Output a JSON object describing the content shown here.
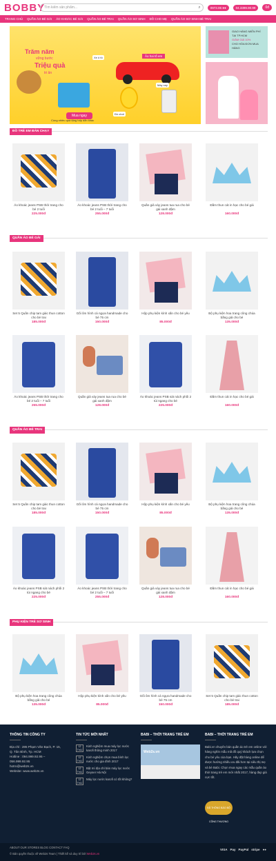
{
  "header": {
    "logo": "BOBBY",
    "search_placeholder": "Tìm kiếm sản phẩm...",
    "hotline_label": "0973.06 ●●",
    "hotline2_label": "04.3399.90.99",
    "cart_label": "0đ"
  },
  "nav": [
    "TRANG CHỦ",
    "QUẦN ÁO BÉ GÁI",
    "ÁO KHOÁC BÉ GÁI",
    "QUẦN ÁO BÉ TRAI",
    "QUẦN ÁO SƠ SINH",
    "ĐỒ CHO MẸ",
    "QUẦN ÁO SƠ SINH BÉ TRAI"
  ],
  "banner": {
    "line1": "Trăm năm",
    "line2": "vững bước",
    "line3": "Triệu quà",
    "line4": "tri ân",
    "button": "Mua ngay",
    "caption": "Cùng nhiều quà tặng hấp dẫn khác",
    "tag": "Ảo hai tố em",
    "label_car": "Xe ô tô",
    "label_chick": "Đồ chơi",
    "label_blender": "Máy xay"
  },
  "side": {
    "text1": "GIAO HÀNG MIỄN PHÍ",
    "text2": "TẠI TP.HCM",
    "text3": "GIẢM GIÁ 10%",
    "text4": "CHO HÓA ĐƠN MUA HÀNG"
  },
  "sections": [
    {
      "title": "ĐỒ TRẺ EM BÁN CHẠY",
      "products": [
        {
          "name": "Áo khoác jeans PSB thời trang cho bé 2 tuổi",
          "price": "225.000đ"
        },
        {
          "name": "Áo khoác jeans PSB thời trang cho bé 2 tuổi – 7 tuổi",
          "price": "255.000đ"
        },
        {
          "name": "Quần giả váy jeans tua rua cho bé gái xanh đậm",
          "price": "128.000đ"
        },
        {
          "name": "Đầm thun cát in hạc cho bé gái",
          "price": "160.000đ"
        }
      ]
    },
    {
      "title": "QUẦN ÁO BÉ GÁI",
      "products": [
        {
          "name": "Set 5 Quần chip tam giác thun cotton cho bé trai",
          "price": "185.000đ"
        },
        {
          "name": "Gối ôm hình cá ngựa handmade cho bé 75 cm",
          "price": "150.000đ"
        },
        {
          "name": "Hộp phụ kiện kính xấn cho bé yêu",
          "price": "85.000đ"
        },
        {
          "name": "Bộ phụ kiện hoa trang công chúa bằng giả cho bé",
          "price": "135.000đ"
        },
        {
          "name": "Áo khoác jeans PSB thời trang cho bé 2 tuổi – 7 tuổi",
          "price": "255.000đ"
        },
        {
          "name": "Quần giả váy jeans tua rua cho bé gái xanh đậm",
          "price": "128.000đ"
        },
        {
          "name": "Áo khoác jeans PSB sát nách phối 2 túi ngang cho bé",
          "price": "225.000đ"
        },
        {
          "name": "Đầm thun cát in hạc cho bé gái",
          "price": "160.000đ"
        }
      ]
    },
    {
      "title": "QUẦN ÁO BÉ TRAI",
      "products": [
        {
          "name": "Set 5 Quần chip tam giác thun cotton cho bé trai",
          "price": "185.000đ"
        },
        {
          "name": "Gối ôm hình cá ngựa handmade cho bé 75 cm",
          "price": "150.000đ"
        },
        {
          "name": "Hộp phụ kiện kính xấn cho bé yêu",
          "price": "85.000đ"
        },
        {
          "name": "Bộ phụ kiện hoa trang công chúa bằng giả cho bé",
          "price": "135.000đ"
        },
        {
          "name": "Áo khoác jeans PSB sát nách phối 2 túi ngang cho bé",
          "price": "225.000đ"
        },
        {
          "name": "Áo khoác jeans PSB thời trang cho bé 2 tuổi – 7 tuổi",
          "price": "255.000đ"
        },
        {
          "name": "Quần giả váy jeans tua rua cho bé gái xanh đậm",
          "price": "128.000đ"
        },
        {
          "name": "Đầm thun cát in hạc cho bé gái",
          "price": "160.000đ"
        }
      ]
    },
    {
      "title": "PHỤ KIỆN TRẺ SƠ SINH",
      "products": [
        {
          "name": "Bộ phụ kiện hoa trang công chúa bằng giả cho bé",
          "price": "135.000đ"
        },
        {
          "name": "Hộp phụ kiện kính xấn cho bé yêu",
          "price": "85.000đ"
        },
        {
          "name": "Gối ôm hình cá ngựa handmade cho bé 75 cm",
          "price": "150.000đ"
        },
        {
          "name": "Set 5 Quần chip tam giác thun cotton cho bé trai",
          "price": "185.000đ"
        }
      ]
    }
  ],
  "footer": {
    "col1_title": "THÔNG TIN CÔNG TY",
    "col1_lines": [
      "Địa chỉ : 285 Phạm Văn Bạch, P. 15,",
      "Q. Tân Bình, Tp. HCM",
      "Hotline : 094.999.92.95 –",
      "056.999.92.95",
      "hotro@web2s.vn",
      "Website: www.web2s.vn"
    ],
    "col2_title": "TIN TỨC MỚI NHẤT",
    "news": [
      {
        "date": "12 Th11",
        "text": "Kinh nghiệm mua máy lọc nước karofi thông minh 2017"
      },
      {
        "date": "12 Th11",
        "text": "Kinh nghiệm chọn mua bình lọc nước cho gia đình 2017"
      },
      {
        "date": "12 Th11",
        "text": "Bật mí địa chỉ bán máy lọc nước Geyser Hà Nội"
      },
      {
        "date": "12 Th11",
        "text": "Máy lọc nước karofi có tốt không?"
      }
    ],
    "col3_title": "BABI – THỜI TRANG TRẺ EM",
    "fb_name": "Web2s.vn",
    "col4_title": "BABI – THỜI TRANG TRẺ EM",
    "col4_text": "Babi.vn chuyên bán quần áo trẻ em online với hàng nghìn mẫu mã đồ quý khách lựa chọn cho bé yêu của bạn. Hãy đặt hàng online để được hướng nhiều ưu đãi hơn tại siêu thị mẹ và bé Babi. Chọn mua ngay các mẫu quần áo thời trang trẻ em mới nhất 2017, hàng đẹp giá cực tốt.",
    "badge": "ĐÃ THÔNG BÁO BỘ CÔNG THƯƠNG",
    "links": "ABOUT   OUR STORES   BLOG   CONTACT   FAQ",
    "copyright": "© Bản quyền thuộc về Web2s Team | Thiết kế và duy trì bởi ",
    "copyright_brand": "Web2s.vn",
    "payments": [
      "VISA",
      "Pay",
      "PayPal",
      "stripe",
      "●●"
    ]
  }
}
